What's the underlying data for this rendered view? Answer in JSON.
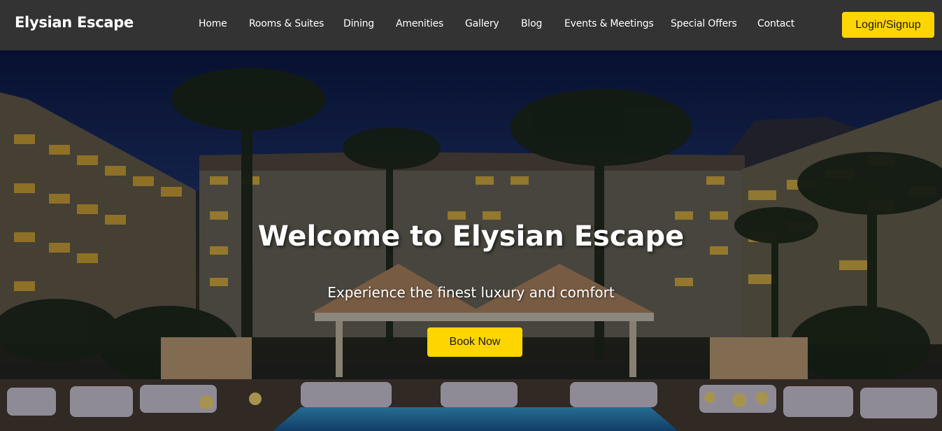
{
  "navbar": {
    "brand": "Elysian Escape",
    "links": [
      "Home",
      "Rooms & Suites",
      "Dining",
      "Amenities",
      "Gallery",
      "Blog",
      "Events & Meetings",
      "Special Offers",
      "Contact"
    ],
    "login_label": "Login/Signup"
  },
  "hero": {
    "title": "Welcome to Elysian Escape",
    "subtitle": "Experience the finest luxury and comfort",
    "cta_label": "Book Now"
  },
  "colors": {
    "navbar_bg": "#333333",
    "accent": "#ffd500",
    "text_light": "#ffffff"
  }
}
